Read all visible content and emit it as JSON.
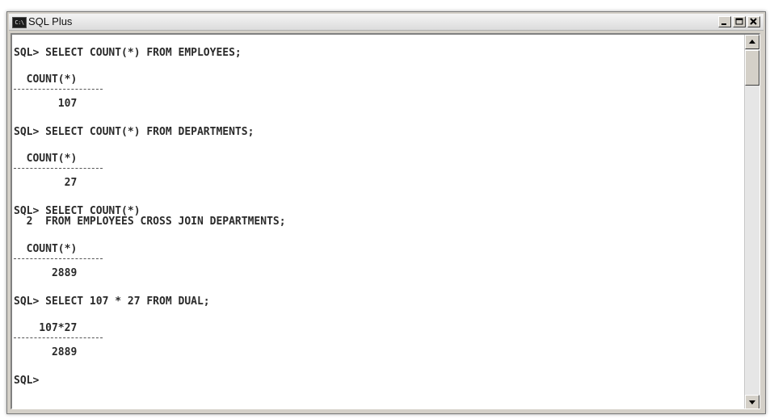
{
  "window": {
    "title": "SQL Plus",
    "icon": "console-icon",
    "icon_text": "C:\\",
    "controls": [
      "minimize-icon",
      "maximize-icon",
      "close-icon"
    ]
  },
  "console": {
    "lines": [
      "SQL> SELECT COUNT(*) FROM EMPLOYEES;",
      "  COUNT(*)",
      "       107",
      "SQL> SELECT COUNT(*) FROM DEPARTMENTS;",
      "  COUNT(*)",
      "        27",
      "SQL> SELECT COUNT(*)",
      "  2  FROM EMPLOYEES CROSS JOIN DEPARTMENTS;",
      "  COUNT(*)",
      "      2889",
      "SQL> SELECT 107 * 27 FROM DUAL;",
      "    107*27",
      "      2889",
      "SQL>"
    ]
  },
  "scrollbar": {
    "orientation": "vertical",
    "position": 0
  }
}
